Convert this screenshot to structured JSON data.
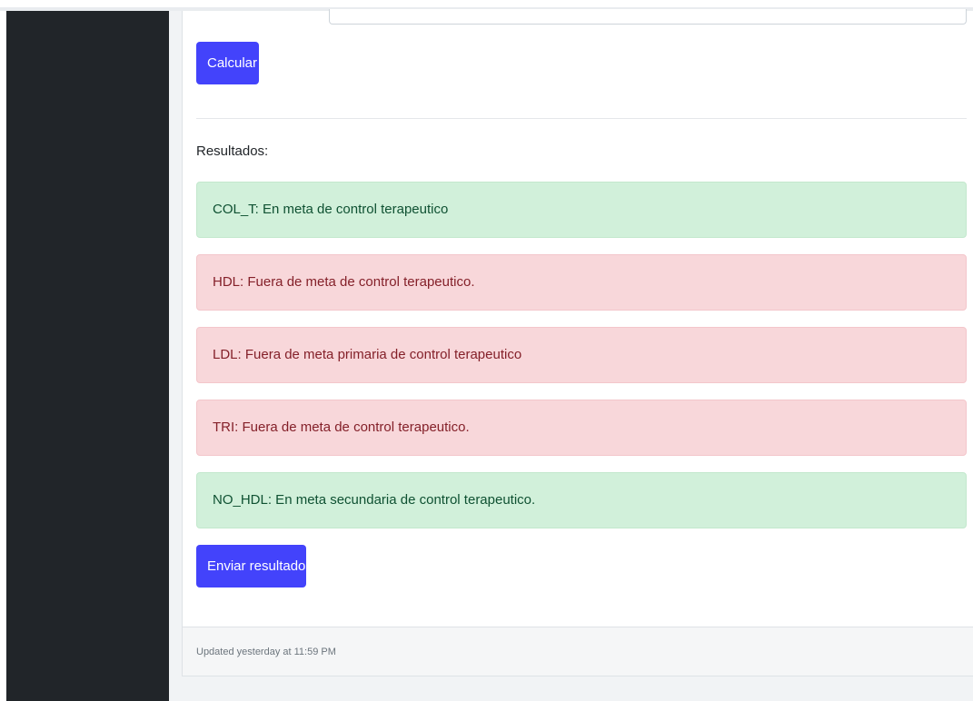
{
  "form": {
    "calculate_label": "Calcular"
  },
  "results": {
    "heading": "Resultados:",
    "items": [
      {
        "text": "COL_T: En meta de control terapeutico",
        "status": "success"
      },
      {
        "text": "HDL: Fuera de meta de control terapeutico.",
        "status": "danger"
      },
      {
        "text": "LDL: Fuera de meta primaria de control terapeutico",
        "status": "danger"
      },
      {
        "text": "TRI: Fuera de meta de control terapeutico.",
        "status": "danger"
      },
      {
        "text": "NO_HDL: En meta secundaria de control terapeutico.",
        "status": "success"
      }
    ],
    "send_label": "Enviar resultados"
  },
  "footer": {
    "updated_text": "Updated yesterday at 11:59 PM"
  },
  "colors": {
    "primary_button": "#4343fb",
    "success_bg": "#d1f0da",
    "success_text": "#0f5132",
    "danger_bg": "#f8d7da",
    "danger_text": "#842029",
    "sidebar_bg": "#212529"
  }
}
